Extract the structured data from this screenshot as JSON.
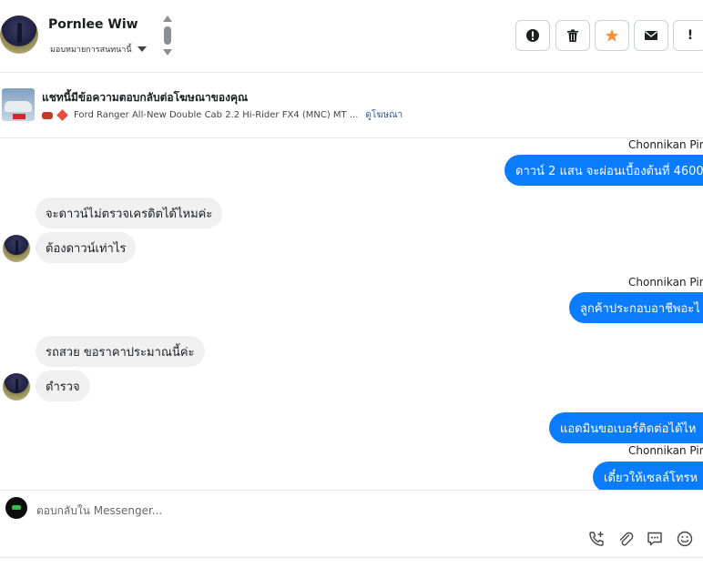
{
  "header": {
    "contact_name": "Pornlee Wiw",
    "assign_label": "มอบหมายการสนทนานี้",
    "actions": [
      {
        "name": "report-icon",
        "label": "!"
      },
      {
        "name": "trash-icon",
        "label": ""
      },
      {
        "name": "star-icon",
        "label": ""
      },
      {
        "name": "mail-icon",
        "label": ""
      },
      {
        "name": "alert-icon",
        "label": "!"
      }
    ]
  },
  "ad": {
    "title": "แชทนี้มีข้อความตอบกลับต่อโฆษณาของคุณ",
    "subtitle": "Ford Ranger All-New Double Cab 2.2 Hi-Rider FX4 (MNC) MT ...",
    "link": "ดูโฆษณา"
  },
  "messages": [
    {
      "dir": "out",
      "sender": "Chonnikan Pim",
      "text": "ดาวน์ 2 แสน จะผ่อนเบื้องต้นที่ 4600"
    },
    {
      "dir": "in",
      "text": "จะดาวน์ไม่ตรวจเครดิตได้ไหมค่ะ"
    },
    {
      "dir": "in",
      "text": "ต้องดาวน์เท่าไร"
    },
    {
      "dir": "out",
      "sender": "Chonnikan Pim",
      "text": "ลูกค้าประกอบอาชีพอะไ"
    },
    {
      "dir": "in",
      "text": "รถสวย ขอราคาประมาณนี้ค่ะ"
    },
    {
      "dir": "in",
      "text": "ตำรวจ"
    },
    {
      "dir": "out",
      "text": "แอดมินขอเบอร์ติดต่อได้ไห"
    },
    {
      "dir": "out",
      "sender": "Chonnikan Pim",
      "text": "เดี๋ยวให้เซลล์โทรห"
    }
  ],
  "composer": {
    "placeholder": "ตอบกลับใน Messenger...",
    "icons": [
      "phone-add-icon",
      "attachment-icon",
      "saved-reply-icon",
      "emoji-icon"
    ]
  },
  "colors": {
    "outgoing_bubble": "#0a7cff",
    "incoming_bubble": "#f0f0f0",
    "star": "#f7923a",
    "link": "#385898"
  }
}
